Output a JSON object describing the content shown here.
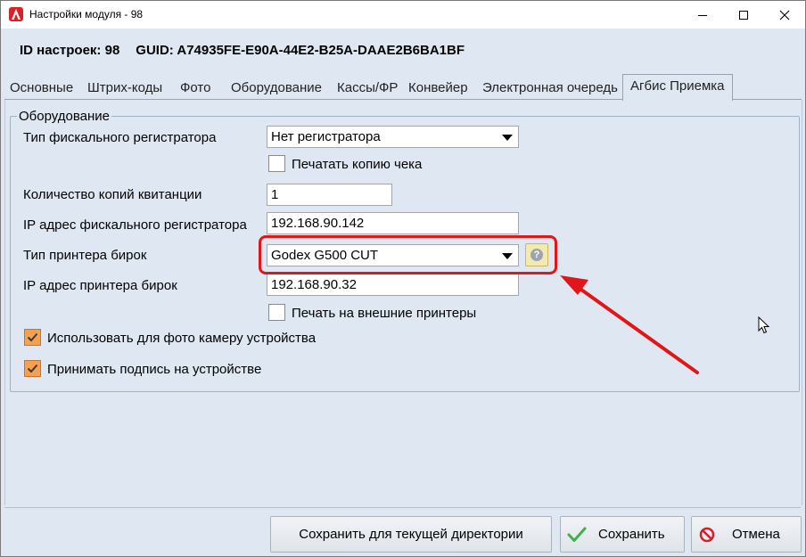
{
  "window": {
    "title": "Настройки модуля  - 98",
    "controls": {
      "minimize": "minimize-icon",
      "maximize": "maximize-icon",
      "close": "close-icon"
    }
  },
  "header": {
    "id_text": "ID настроек: 98",
    "guid_text": "GUID: A74935FE-E90A-44E2-B25A-DAAE2B6BA1BF"
  },
  "tabs": [
    {
      "label": "Основные"
    },
    {
      "label": "Штрих-коды"
    },
    {
      "label": "Фото"
    },
    {
      "label": "Оборудование"
    },
    {
      "label": "Кассы/ФР"
    },
    {
      "label": "Конвейер"
    },
    {
      "label": "Электронная очередь"
    },
    {
      "label": "Агбис Приемка",
      "active": true
    }
  ],
  "group": {
    "title": "Оборудование",
    "fiscal_type_label": "Тип фискального регистратора",
    "fiscal_type_value": "Нет регистратора",
    "print_copy_label": "Печатать копию чека",
    "print_copy_checked": false,
    "copies_label": "Количество копий квитанции",
    "copies_value": "1",
    "fiscal_ip_label": "IP адрес фискального регистратора",
    "fiscal_ip_value": "192.168.90.142",
    "tag_printer_type_label": "Тип принтера бирок",
    "tag_printer_type_value": "Godex G500 CUT",
    "help_glyph": "?",
    "tag_printer_ip_label": "IP адрес принтера бирок",
    "tag_printer_ip_value": "192.168.90.32",
    "external_print_label": "Печать на внешние принтеры",
    "external_print_checked": false,
    "use_camera_label": "Использовать для фото камеру устройства",
    "use_camera_checked": true,
    "accept_signature_label": "Принимать подпись на устройстве",
    "accept_signature_checked": true
  },
  "buttons": {
    "save_dir": "Сохранить для текущей директории",
    "save": "Сохранить",
    "cancel": "Отмена"
  },
  "colors": {
    "background": "#dfe8f2",
    "highlight": "#e0161a",
    "checkbox_checked": "#f6a052",
    "save_check": "#3bb34a",
    "cancel_icon": "#d31f26"
  }
}
